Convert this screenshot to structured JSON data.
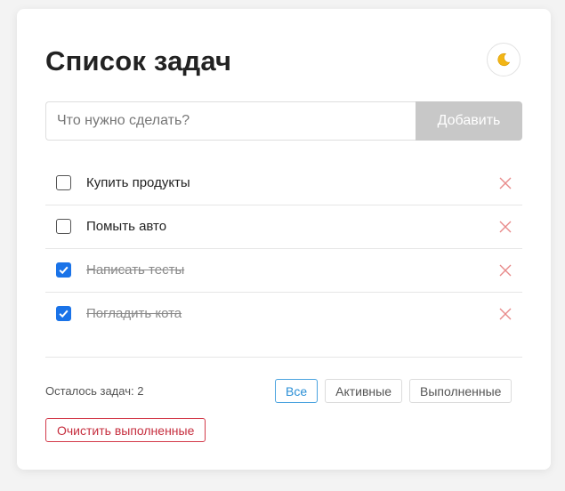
{
  "header": {
    "title": "Список задач",
    "theme_toggle_icon": "moon-icon"
  },
  "new_task": {
    "placeholder": "Что нужно сделать?",
    "value": "",
    "add_label": "Добавить"
  },
  "tasks": [
    {
      "text": "Купить продукты",
      "completed": false
    },
    {
      "text": "Помыть авто",
      "completed": false
    },
    {
      "text": "Написать тесты",
      "completed": true
    },
    {
      "text": "Погладить кота",
      "completed": true
    }
  ],
  "footer": {
    "remaining_text": "Осталось задач: 2",
    "filters": [
      {
        "label": "Все",
        "active": true
      },
      {
        "label": "Активные",
        "active": false
      },
      {
        "label": "Выполненные",
        "active": false
      }
    ],
    "clear_label": "Очистить выполненные"
  },
  "colors": {
    "accent": "#1a73e8",
    "active_filter": "#2a8fd6",
    "danger": "#c62f3f",
    "delete_icon": "#e88a8a",
    "add_button_bg": "#c8c8c8"
  }
}
